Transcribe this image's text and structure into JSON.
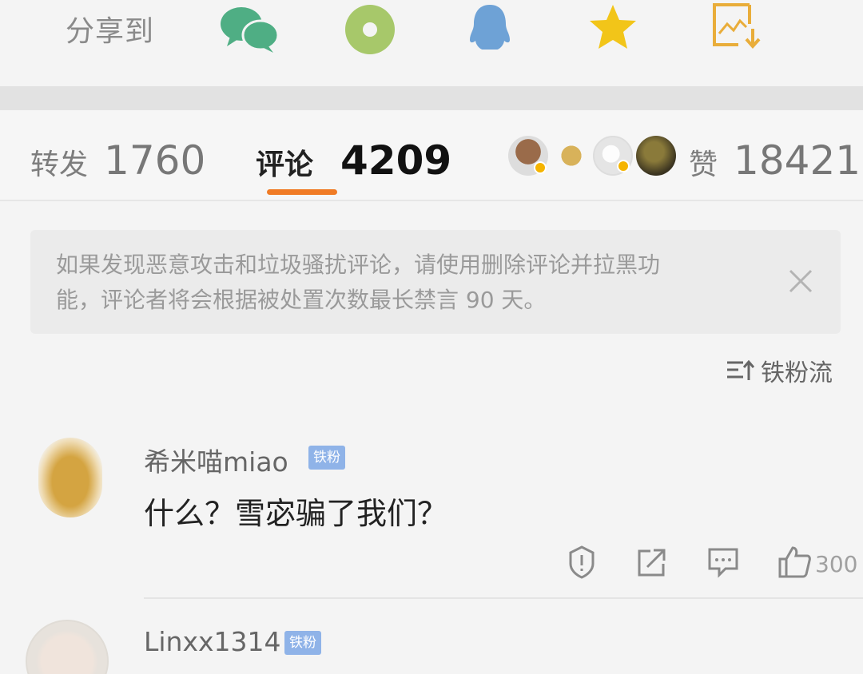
{
  "share": {
    "label": "分享到",
    "icons": [
      "wechat-icon",
      "moments-icon",
      "qq-icon",
      "favorite-star-icon",
      "save-image-icon"
    ]
  },
  "counts": {
    "repost_label": "转发",
    "repost_count": "1760",
    "comment_label": "评论",
    "comment_count": "4209",
    "like_label": "赞",
    "like_count": "18421"
  },
  "notice": {
    "line1": "如果发现恶意攻击和垃圾骚扰评论，请使用删除评论并拉黑功",
    "line2": "能，评论者将会根据被处置次数最长禁言 90 天。"
  },
  "sort": {
    "label": "铁粉流"
  },
  "comments": [
    {
      "username": "希米喵miao",
      "badge": "铁粉",
      "text": "什么？雪宓骗了我们？",
      "like_count": "300"
    },
    {
      "username": "Linxx1314",
      "badge": "铁粉"
    }
  ],
  "colors": {
    "accent_tab": "#f07b25",
    "wechat": "#4fae84",
    "moments": "#a7c86a",
    "qq": "#6ea2d6",
    "star": "#f2c519",
    "save": "#e9ad3a",
    "badge": "#8fb3e8"
  }
}
